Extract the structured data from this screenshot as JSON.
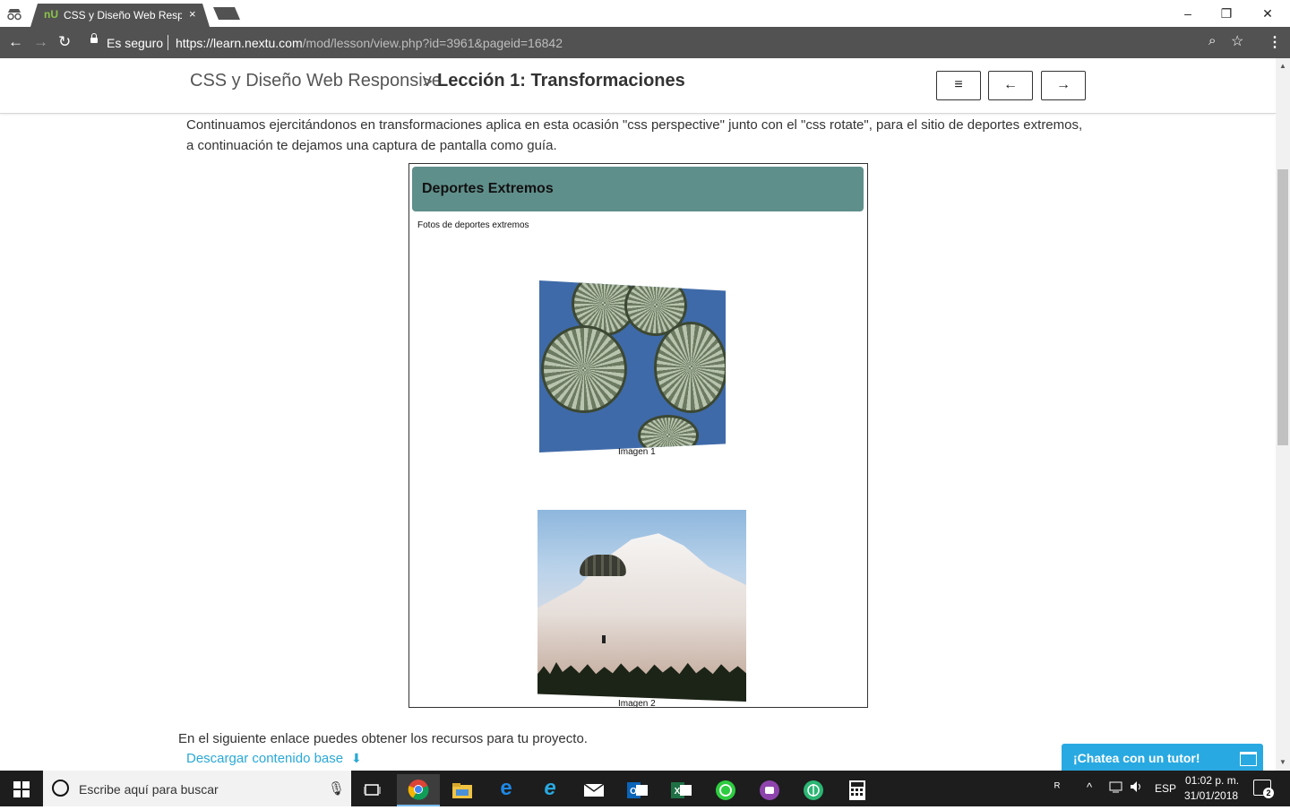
{
  "browser": {
    "tab": {
      "favicon": "nU",
      "title": "CSS y Diseño Web Responsive",
      "close": "×"
    },
    "window_controls": {
      "minimize": "–",
      "restore": "❐",
      "close": "✕"
    },
    "nav": {
      "back": "←",
      "forward": "→",
      "reload": "↻"
    },
    "omnibox": {
      "secure_label": "Es seguro",
      "url_host": "https://learn.nextu.com",
      "url_path": "/mod/lesson/view.php?id=3961&pageid=16842"
    },
    "icons": {
      "zoom": "⌕",
      "star": "☆",
      "menu": "⋮",
      "incognito": "incognito-icon"
    }
  },
  "lesson_header": {
    "course": "CSS y Diseño Web Responsive",
    "separator": ">",
    "lesson": "Lección 1: Transformaciones",
    "buttons": {
      "menu": "≡",
      "prev": "←",
      "next": "→"
    }
  },
  "content": {
    "intro": "Continuamos ejercitándonos en transformaciones aplica en esta ocasión \"css perspective\" junto con el \"css rotate\", para el sitio de deportes extremos, a continuación te dejamos una captura de pantalla como guía.",
    "figure": {
      "header_title": "Deportes Extremos",
      "subtitle": "Fotos de deportes extremos",
      "caption1": "Imagen 1",
      "caption2": "Imagen 2"
    },
    "resources_text": "En el siguiente enlace puedes obtener los recursos para tu proyecto.",
    "download_link": "Descargar contenido base",
    "download_icon": "⬇"
  },
  "chat": {
    "label": "¡Chatea con un tutor!"
  },
  "scrollbar": {
    "up": "▲",
    "down": "▼"
  },
  "taskbar": {
    "search_placeholder": "Escribe aquí para buscar",
    "mic": "🎙",
    "apps": [
      "task-view",
      "chrome",
      "file-explorer",
      "edge",
      "internet-explorer",
      "mail",
      "outlook",
      "excel",
      "whatsapp",
      "twitch",
      "app",
      "calculator"
    ],
    "tray": {
      "language": "ESP",
      "time": "01:02 p. m.",
      "date": "31/01/2018",
      "notifications": "2"
    }
  },
  "colors": {
    "tab_bg": "#525252",
    "figure_header": "#5f8f8b",
    "link": "#2aa9d6",
    "chat": "#29a9e1",
    "taskbar": "#1d1d1d"
  }
}
